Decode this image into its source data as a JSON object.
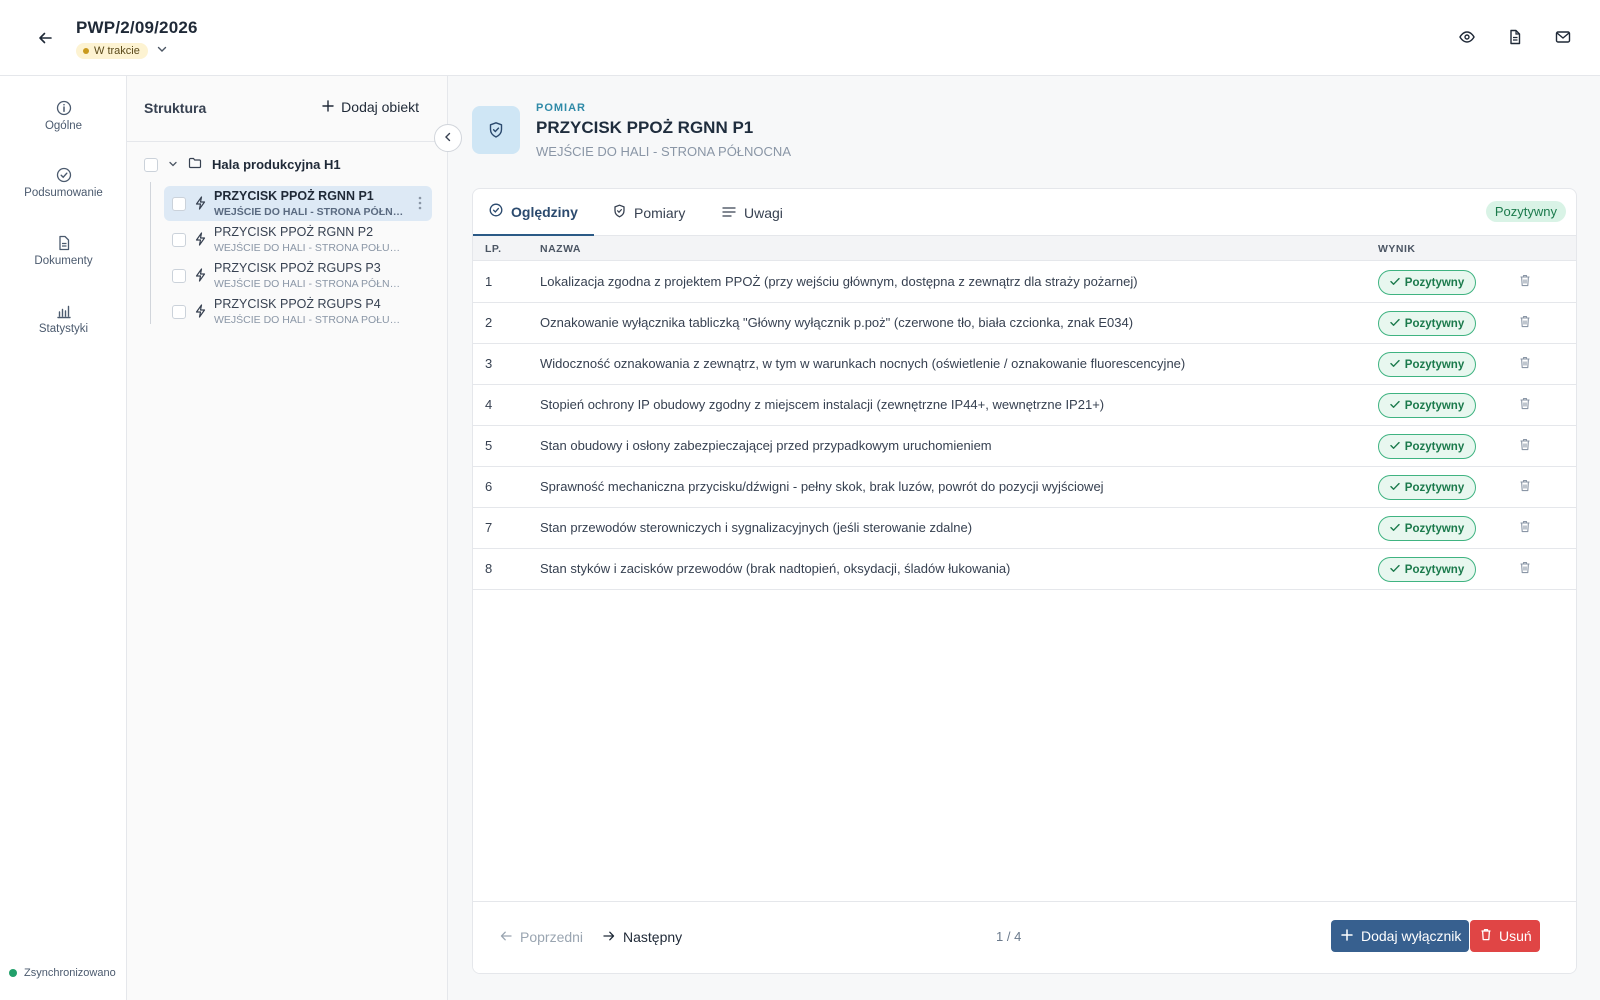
{
  "header": {
    "title": "PWP/2/09/2026",
    "status": "W trakcie"
  },
  "nav": {
    "items": [
      {
        "label": "Ogólne",
        "icon": "info-icon"
      },
      {
        "label": "Podsumowanie",
        "icon": "check-circle-icon"
      },
      {
        "label": "Dokumenty",
        "icon": "document-icon"
      },
      {
        "label": "Statystyki",
        "icon": "bar-chart-icon"
      }
    ],
    "sync_status": "Zsynchronizowano"
  },
  "structure": {
    "title": "Struktura",
    "add_label": "Dodaj obiekt",
    "root": "Hala produkcyjna H1",
    "items": [
      {
        "title": "PRZYCISK PPOŻ RGNN P1",
        "subtitle": "WEJŚCIE DO HALI - STRONA PÓŁNOCNA",
        "selected": true
      },
      {
        "title": "PRZYCISK PPOŻ RGNN P2",
        "subtitle": "WEJŚCIE DO HALI - STRONA POŁUDNIOWA",
        "selected": false
      },
      {
        "title": "PRZYCISK PPOŻ RGUPS P3",
        "subtitle": "WEJŚCIE DO HALI - STRONA PÓŁNOCNA",
        "selected": false
      },
      {
        "title": "PRZYCISK PPOŻ RGUPS P4",
        "subtitle": "WEJŚCIE DO HALI - STRONA POŁUDNIOWA",
        "selected": false
      }
    ]
  },
  "main": {
    "kicker": "POMIAR",
    "title": "PRZYCISK PPOŻ RGNN P1",
    "subtitle": "WEJŚCIE DO HALI - STRONA PÓŁNOCNA",
    "tabs": [
      {
        "label": "Oględziny",
        "icon": "check-circle-icon",
        "active": true
      },
      {
        "label": "Pomiary",
        "icon": "shield-icon",
        "active": false
      },
      {
        "label": "Uwagi",
        "icon": "lines-icon",
        "active": false
      }
    ],
    "overall_result": "Pozytywny",
    "table": {
      "headers": {
        "lp": "LP.",
        "name": "NAZWA",
        "result": "WYNIK"
      },
      "rows": [
        {
          "lp": "1",
          "name": "Lokalizacja zgodna z projektem PPOŻ (przy wejściu głównym, dostępna z zewnątrz dla straży pożarnej)",
          "result": "Pozytywny"
        },
        {
          "lp": "2",
          "name": "Oznakowanie wyłącznika tabliczką \"Główny wyłącznik p.poż\" (czerwone tło, biała czcionka, znak E034)",
          "result": "Pozytywny"
        },
        {
          "lp": "3",
          "name": "Widoczność oznakowania z zewnątrz, w tym w warunkach nocnych (oświetlenie / oznakowanie fluorescencyjne)",
          "result": "Pozytywny"
        },
        {
          "lp": "4",
          "name": "Stopień ochrony IP obudowy zgodny z miejscem instalacji (zewnętrzne IP44+, wewnętrzne IP21+)",
          "result": "Pozytywny"
        },
        {
          "lp": "5",
          "name": "Stan obudowy i osłony zabezpieczającej przed przypadkowym uruchomieniem",
          "result": "Pozytywny"
        },
        {
          "lp": "6",
          "name": "Sprawność mechaniczna przycisku/dźwigni - pełny skok, brak luzów, powrót do pozycji wyjściowej",
          "result": "Pozytywny"
        },
        {
          "lp": "7",
          "name": "Stan przewodów sterowniczych i sygnalizacyjnych (jeśli sterowanie zdalne)",
          "result": "Pozytywny"
        },
        {
          "lp": "8",
          "name": "Stan styków i zacisków przewodów (brak nadtopień, oksydacji, śladów łukowania)",
          "result": "Pozytywny"
        }
      ]
    },
    "footer": {
      "prev_label": "Poprzedni",
      "next_label": "Następny",
      "pager": "1 / 4",
      "add_label": "Dodaj wyłącznik",
      "delete_label": "Usuń"
    }
  },
  "colors": {
    "primary": "#37608f",
    "danger": "#e04545",
    "success": "#3fb381",
    "status_pending": "#fdf3d2"
  }
}
